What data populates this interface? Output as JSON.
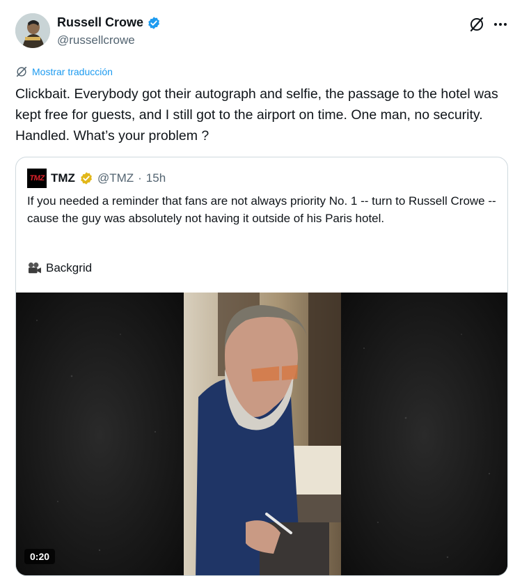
{
  "author": {
    "name": "Russell Crowe",
    "handle": "@russellcrowe",
    "verified_color": "#1d9bf0"
  },
  "header_icons": [
    "grok-icon",
    "more-icon"
  ],
  "translate_label": "Mostrar traducción",
  "tweet_text": "Clickbait. Everybody got their autograph and selfie, the passage to the hotel was kept free for guests, and I still got to the airport on time. One man, no security. Handled. What’s your problem ?",
  "quote": {
    "logo_text": "TMZ",
    "name": "TMZ",
    "handle": "@TMZ",
    "separator": "·",
    "time": "15h",
    "text": "If you needed a reminder that fans are not always priority No. 1 -- turn to Russell Crowe -- cause the guy was absolutely not having it outside of his Paris hotel.",
    "credit": "Backgrid",
    "verified_color": "#e2b719",
    "video_duration": "0:20"
  }
}
